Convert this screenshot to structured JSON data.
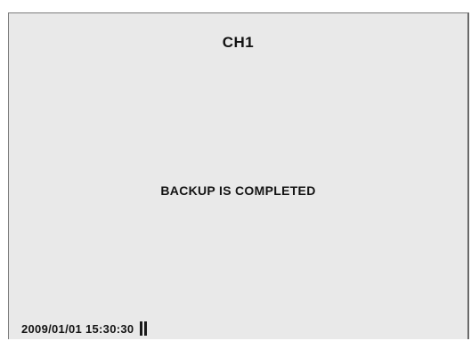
{
  "screen": {
    "channel_label": "CH1",
    "status_message": "BACKUP IS COMPLETED",
    "timestamp": "2009/01/01 15:30:30",
    "indicator_icon": "recording-pause-bars-icon"
  }
}
